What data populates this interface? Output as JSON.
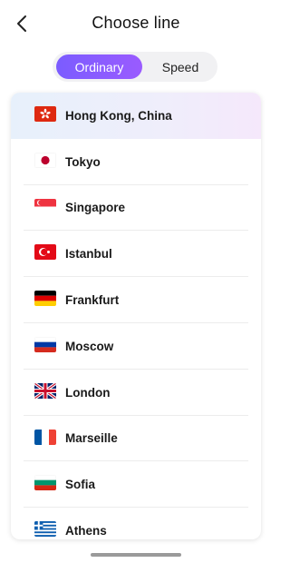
{
  "header": {
    "title": "Choose line",
    "back_icon": "chevron-left-icon"
  },
  "tabs": [
    {
      "label": "Ordinary",
      "active": true
    },
    {
      "label": "Speed",
      "active": false
    }
  ],
  "accent_colors": {
    "tab_active_start": "#7b5cff",
    "tab_active_end": "#9a5bff"
  },
  "lines": [
    {
      "name": "Hong Kong, China",
      "flag": "hong-kong-flag-icon",
      "selected": true
    },
    {
      "name": "Tokyo",
      "flag": "japan-flag-icon",
      "selected": false
    },
    {
      "name": "Singapore",
      "flag": "singapore-flag-icon",
      "selected": false
    },
    {
      "name": "Istanbul",
      "flag": "turkey-flag-icon",
      "selected": false
    },
    {
      "name": "Frankfurt",
      "flag": "germany-flag-icon",
      "selected": false
    },
    {
      "name": "Moscow",
      "flag": "russia-flag-icon",
      "selected": false
    },
    {
      "name": "London",
      "flag": "uk-flag-icon",
      "selected": false
    },
    {
      "name": "Marseille",
      "flag": "france-flag-icon",
      "selected": false
    },
    {
      "name": "Sofia",
      "flag": "bulgaria-flag-icon",
      "selected": false
    },
    {
      "name": "Athens",
      "flag": "greece-flag-icon",
      "selected": false
    }
  ]
}
